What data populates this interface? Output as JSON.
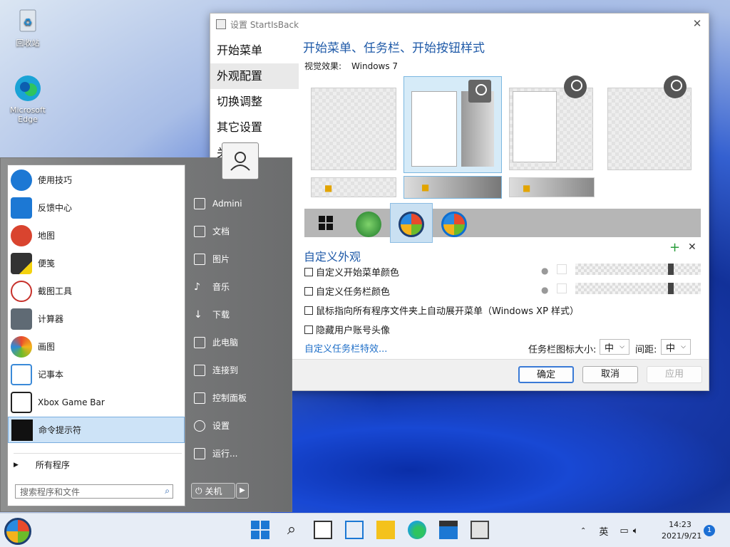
{
  "desktop": {
    "icons": [
      {
        "label": "回收站"
      },
      {
        "label": "Microsoft Edge"
      }
    ]
  },
  "settings": {
    "title": "设置 StartIsBack",
    "nav": [
      "开始菜单",
      "外观配置",
      "切换调整",
      "其它设置",
      "关于"
    ],
    "active_nav": "外观配置",
    "heading": "开始菜单、任务栏、开始按钮样式",
    "visual_label": "视觉效果:",
    "visual_value": "Windows 7",
    "custom_heading": "自定义外观",
    "options": [
      {
        "label": "自定义开始菜单颜色",
        "checked": false
      },
      {
        "label": "自定义任务栏颜色",
        "checked": false
      },
      {
        "label": "鼠标指向所有程序文件夹上自动展开菜单（Windows XP 样式）",
        "checked": false
      },
      {
        "label": "隐藏用户账号头像",
        "checked": false
      }
    ],
    "link": "自定义任务栏特效...",
    "icon_size_label": "任务栏图标大小:",
    "icon_size_value": "中",
    "spacing_label": "间距:",
    "spacing_value": "中",
    "buttons": {
      "ok": "确定",
      "cancel": "取消",
      "apply": "应用"
    }
  },
  "startmenu": {
    "items": [
      {
        "label": "使用技巧",
        "color": "#1c78d4"
      },
      {
        "label": "反馈中心",
        "color": "#1c78d4"
      },
      {
        "label": "地图",
        "color": "#d9442f"
      },
      {
        "label": "便笺",
        "color": "#333333"
      },
      {
        "label": "截图工具",
        "color": "#c7312b"
      },
      {
        "label": "计算器",
        "color": "#5f6a74"
      },
      {
        "label": "画图",
        "color": "#2d8ad8"
      },
      {
        "label": "记事本",
        "color": "#3b8ad8"
      },
      {
        "label": "Xbox Game Bar",
        "color": "#222222"
      },
      {
        "label": "命令提示符",
        "color": "#111111"
      }
    ],
    "selected": "命令提示符",
    "all_programs": "所有程序",
    "search_placeholder": "搜索程序和文件",
    "right": [
      "Admini",
      "文档",
      "图片",
      "音乐",
      "下载",
      "此电脑",
      "连接到",
      "控制面板",
      "设置",
      "运行..."
    ],
    "shutdown": "关机"
  },
  "taskbar": {
    "lang": "英",
    "time": "14:23",
    "date": "2021/9/21",
    "notification_count": "1"
  }
}
